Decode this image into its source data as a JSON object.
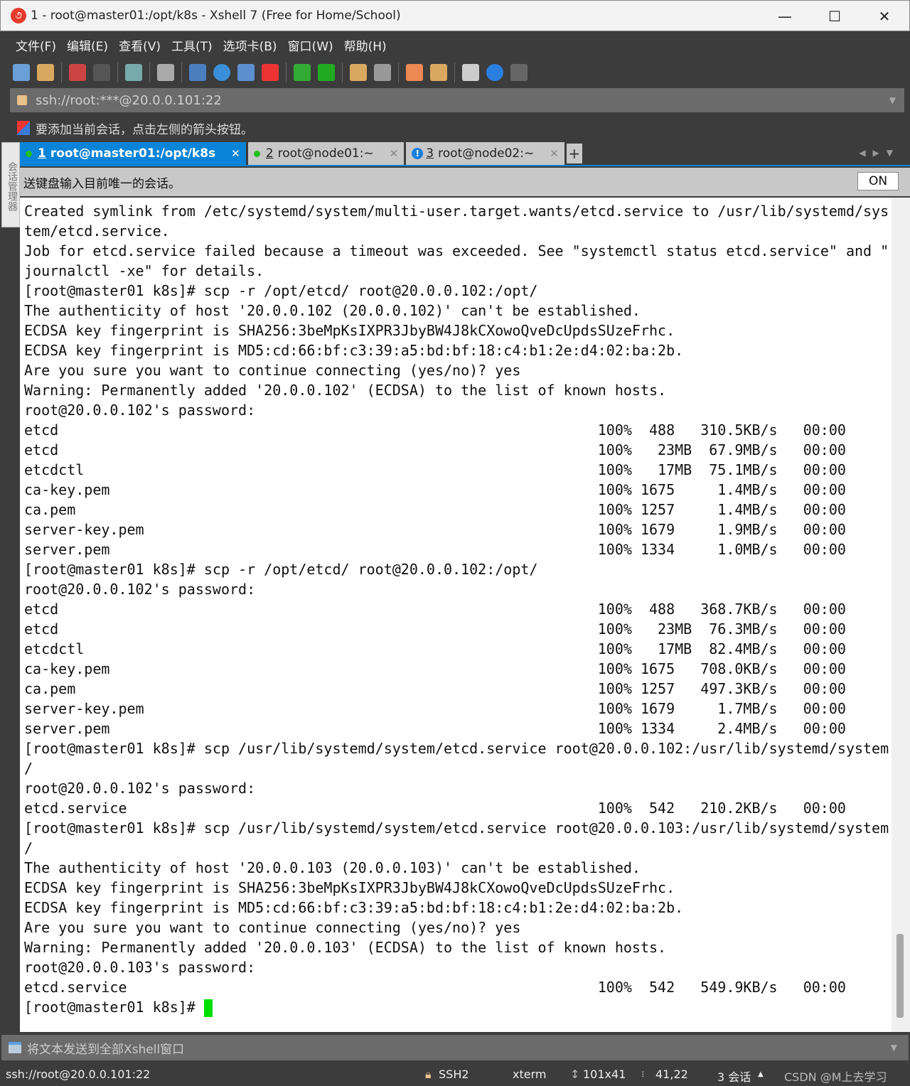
{
  "window": {
    "title": "1 - root@master01:/opt/k8s - Xshell 7 (Free for Home/School)",
    "minimize": "—",
    "maximize": "☐",
    "close": "✕"
  },
  "menu": [
    "文件(F)",
    "编辑(E)",
    "查看(V)",
    "工具(T)",
    "选项卡(B)",
    "窗口(W)",
    "帮助(H)"
  ],
  "toolbar_icons": [
    "new-session",
    "open-folder",
    "disconnect",
    "reconnect",
    "properties",
    "find",
    "transfer",
    "globe",
    "font",
    "xshell",
    "xftp",
    "fullscreen",
    "lock",
    "keyboard",
    "highlight",
    "new-tab",
    "layout",
    "help",
    "chat"
  ],
  "address": {
    "value": "ssh://root:***@20.0.0.101:22"
  },
  "hint": "要添加当前会话，点击左侧的箭头按钮。",
  "session_manager": "会话管理器",
  "tabs": [
    {
      "num": "1",
      "label": "root@master01:/opt/k8s",
      "status": "connected",
      "active": true
    },
    {
      "num": "2",
      "label": "root@node01:~",
      "status": "connected"
    },
    {
      "num": "3",
      "label": "root@node02:~",
      "status": "warning"
    }
  ],
  "compose": {
    "text": "送键盘输入目前唯一的会话。",
    "toggle": "ON"
  },
  "terminal": {
    "lines": [
      "Created symlink from /etc/systemd/system/multi-user.target.wants/etcd.service to /usr/lib/systemd/sys",
      "tem/etcd.service.",
      "Job for etcd.service failed because a timeout was exceeded. See \"systemctl status etcd.service\" and \"",
      "journalctl -xe\" for details.",
      "[root@master01 k8s]# scp -r /opt/etcd/ root@20.0.0.102:/opt/",
      "The authenticity of host '20.0.0.102 (20.0.0.102)' can't be established.",
      "ECDSA key fingerprint is SHA256:3beMpKsIXPR3JbyBW4J8kCXowoQveDcUpdsSUzeFrhc.",
      "ECDSA key fingerprint is MD5:cd:66:bf:c3:39:a5:bd:bf:18:c4:b1:2e:d4:02:ba:2b.",
      "Are you sure you want to continue connecting (yes/no)? yes",
      "Warning: Permanently added '20.0.0.102' (ECDSA) to the list of known hosts.",
      "root@20.0.0.102's password:",
      {
        "file": "etcd",
        "stats": "100%  488   310.5KB/s   00:00"
      },
      {
        "file": "etcd",
        "stats": "100%   23MB  67.9MB/s   00:00"
      },
      {
        "file": "etcdctl",
        "stats": "100%   17MB  75.1MB/s   00:00"
      },
      {
        "file": "ca-key.pem",
        "stats": "100% 1675     1.4MB/s   00:00"
      },
      {
        "file": "ca.pem",
        "stats": "100% 1257     1.4MB/s   00:00"
      },
      {
        "file": "server-key.pem",
        "stats": "100% 1679     1.9MB/s   00:00"
      },
      {
        "file": "server.pem",
        "stats": "100% 1334     1.0MB/s   00:00"
      },
      "[root@master01 k8s]# scp -r /opt/etcd/ root@20.0.0.102:/opt/",
      "root@20.0.0.102's password:",
      {
        "file": "etcd",
        "stats": "100%  488   368.7KB/s   00:00"
      },
      {
        "file": "etcd",
        "stats": "100%   23MB  76.3MB/s   00:00"
      },
      {
        "file": "etcdctl",
        "stats": "100%   17MB  82.4MB/s   00:00"
      },
      {
        "file": "ca-key.pem",
        "stats": "100% 1675   708.0KB/s   00:00"
      },
      {
        "file": "ca.pem",
        "stats": "100% 1257   497.3KB/s   00:00"
      },
      {
        "file": "server-key.pem",
        "stats": "100% 1679     1.7MB/s   00:00"
      },
      {
        "file": "server.pem",
        "stats": "100% 1334     2.4MB/s   00:00"
      },
      "[root@master01 k8s]# scp /usr/lib/systemd/system/etcd.service root@20.0.0.102:/usr/lib/systemd/system",
      "/",
      "root@20.0.0.102's password:",
      {
        "file": "etcd.service",
        "stats": "100%  542   210.2KB/s   00:00"
      },
      "[root@master01 k8s]# scp /usr/lib/systemd/system/etcd.service root@20.0.0.103:/usr/lib/systemd/system",
      "/",
      "The authenticity of host '20.0.0.103 (20.0.0.103)' can't be established.",
      "ECDSA key fingerprint is SHA256:3beMpKsIXPR3JbyBW4J8kCXowoQveDcUpdsSUzeFrhc.",
      "ECDSA key fingerprint is MD5:cd:66:bf:c3:39:a5:bd:bf:18:c4:b1:2e:d4:02:ba:2b.",
      "Are you sure you want to continue connecting (yes/no)? yes",
      "Warning: Permanently added '20.0.0.103' (ECDSA) to the list of known hosts.",
      "root@20.0.0.103's password:",
      {
        "file": "etcd.service",
        "stats": "100%  542   549.9KB/s   00:00"
      }
    ],
    "prompt": "[root@master01 k8s]# "
  },
  "sendbar": {
    "text": "将文本发送到全部Xshell窗口"
  },
  "status": {
    "address": "ssh://root@20.0.0.101:22",
    "protocol": "SSH2",
    "term": "xterm",
    "size": "101x41",
    "cursor": "41,22",
    "sessions": "3 会话",
    "watermark": "CSDN @M上去学习"
  },
  "colors": {
    "accent": "#0a84d8",
    "cursor": "#00e000"
  }
}
